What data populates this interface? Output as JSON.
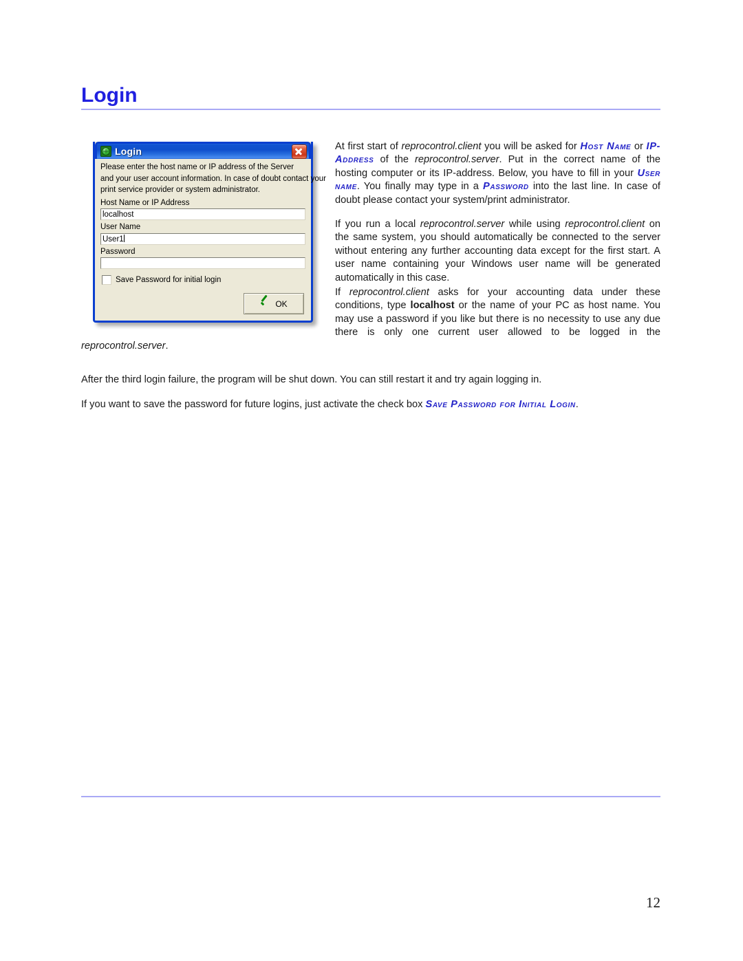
{
  "heading": "Login",
  "dialog": {
    "title": "Login",
    "icon": "globe-icon",
    "close_label": "×",
    "instructions": [
      "Please enter the host name or IP address of the Server",
      "and your user account information. In case of doubt contact your",
      "print service provider or system administrator."
    ],
    "fields": [
      {
        "label": "Host Name or IP Address",
        "value": "localhost",
        "caret": false
      },
      {
        "label": "User Name",
        "value": "User1",
        "caret": true
      },
      {
        "label": "Password",
        "value": "",
        "caret": false
      }
    ],
    "checkbox": {
      "label": "Save Password for initial login",
      "checked": false
    },
    "ok_button": "OK"
  },
  "paragraphs": {
    "p1": {
      "t1": "At first start of ",
      "i1": "reprocontrol.client",
      "t2": " you will be asked for ",
      "sc1": "Host Name",
      "t3": " or ",
      "sc2": "IP-Address",
      "t4": " of the ",
      "i2": "reprocontrol.server",
      "t5": ". Put in the correct name of the hosting computer or its IP-address. Below, you have to fill in your ",
      "sc3": "User name",
      "t6": ". You finally may type in a ",
      "sc4": "Password",
      "t7": " into the last line. In case of doubt please contact your system/print administrator."
    },
    "p2": {
      "t1": "If you run a local ",
      "i1": "reprocontrol.server",
      "t2": " while using ",
      "i2": "reprocontrol.client",
      "t3": " on the same system, you should automatically be connected to the server without entering any further accounting data except for the first start. A user name containing your Windows user name will be generated automatically in this case."
    },
    "p3": {
      "t1": "If ",
      "i1": "reprocontrol.client",
      "t2": " asks for your accounting data under these conditions, type ",
      "b1": "localhost",
      "t3": " or the name of your PC as host name. You may use a password if you like but there is no necessity to use any due there is only one current user allowed to be logged in the ",
      "i2": "reprocontrol.server",
      "t4": "."
    },
    "p4": {
      "t1": "After the third login failure, the program will be shut down. You can still restart it and try again logging in."
    },
    "p5": {
      "t1": "If you want to save the password for future logins, just activate the check box ",
      "sc1": "Save Password for Initial Login",
      "t2": "."
    }
  },
  "footer": {
    "page_number": "12"
  },
  "colors": {
    "heading": "#2020e0",
    "rule": "#a9a9f5",
    "smallcaps": "#2424c8",
    "dialog_face": "#ece9d8",
    "titlebar": "#0f4fcc",
    "close_button": "#c9341a",
    "check_green": "#0a8a0a"
  }
}
